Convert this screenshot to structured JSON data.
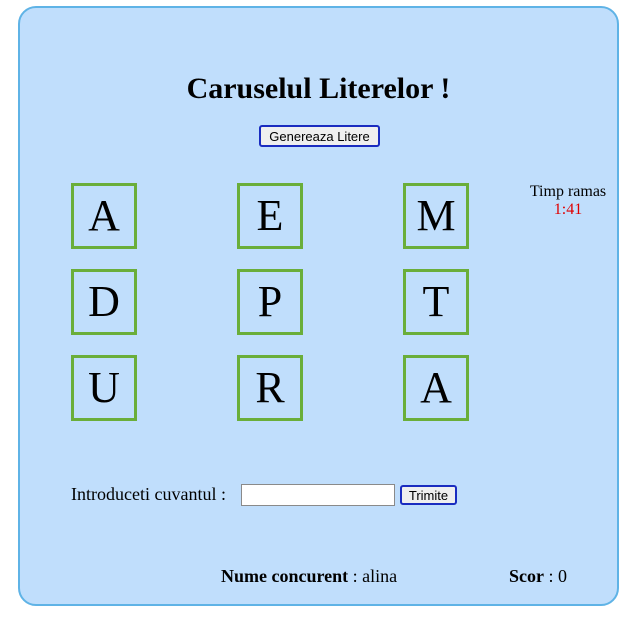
{
  "game": {
    "title": "Caruselul Literelor !",
    "generate_button": "Genereaza Litere",
    "letters": [
      "A",
      "E",
      "M",
      "D",
      "P",
      "T",
      "U",
      "R",
      "A"
    ],
    "timer": {
      "label": "Timp ramas",
      "value": "1:41"
    },
    "word_entry": {
      "label": "Introduceti cuvantul :",
      "value": "",
      "submit_label": "Trimite"
    },
    "player": {
      "label": "Nume concurent",
      "separator": " : ",
      "name": "alina"
    },
    "score": {
      "label": "Scor",
      "separator": " : ",
      "value": "0"
    }
  },
  "colors": {
    "panel_bg": "#c0defc",
    "panel_border": "#5fb3e6",
    "tile_border": "#6aae3a",
    "timer_value": "#e00000",
    "button_border": "#1a2cc0"
  }
}
